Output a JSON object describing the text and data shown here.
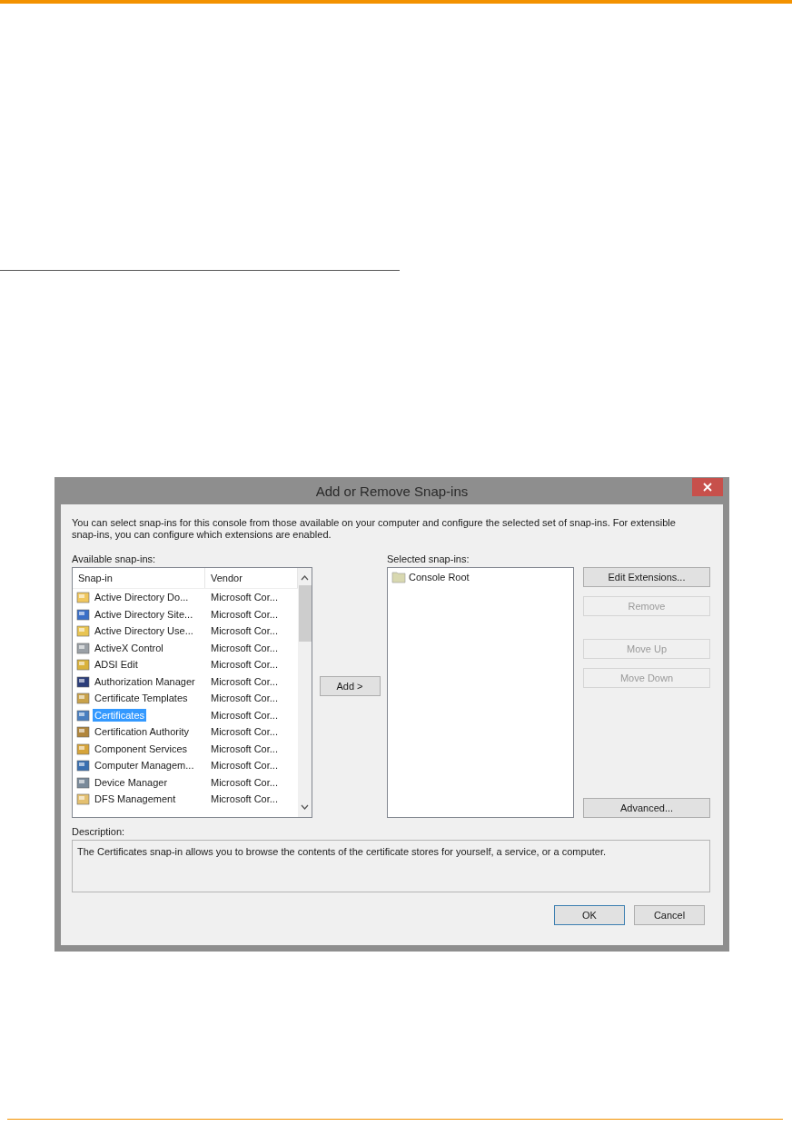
{
  "dialog": {
    "title": "Add or Remove Snap-ins",
    "intro": "You can select snap-ins for this console from those available on your computer and configure the selected set of snap-ins. For extensible snap-ins, you can configure which extensions are enabled.",
    "available_label": "Available snap-ins:",
    "available": {
      "columns": [
        "Snap-in",
        "Vendor"
      ],
      "rows": [
        {
          "name": "Active Directory Do...",
          "vendor": "Microsoft Cor...",
          "selected": false
        },
        {
          "name": "Active Directory Site...",
          "vendor": "Microsoft Cor...",
          "selected": false
        },
        {
          "name": "Active Directory Use...",
          "vendor": "Microsoft Cor...",
          "selected": false
        },
        {
          "name": "ActiveX Control",
          "vendor": "Microsoft Cor...",
          "selected": false
        },
        {
          "name": "ADSI Edit",
          "vendor": "Microsoft Cor...",
          "selected": false
        },
        {
          "name": "Authorization Manager",
          "vendor": "Microsoft Cor...",
          "selected": false
        },
        {
          "name": "Certificate Templates",
          "vendor": "Microsoft Cor...",
          "selected": false
        },
        {
          "name": "Certificates",
          "vendor": "Microsoft Cor...",
          "selected": true
        },
        {
          "name": "Certification Authority",
          "vendor": "Microsoft Cor...",
          "selected": false
        },
        {
          "name": "Component Services",
          "vendor": "Microsoft Cor...",
          "selected": false
        },
        {
          "name": "Computer Managem...",
          "vendor": "Microsoft Cor...",
          "selected": false
        },
        {
          "name": "Device Manager",
          "vendor": "Microsoft Cor...",
          "selected": false
        },
        {
          "name": "DFS Management",
          "vendor": "Microsoft Cor...",
          "selected": false
        }
      ]
    },
    "add_button": "Add >",
    "selected_label": "Selected snap-ins:",
    "selected_items": [
      {
        "label": "Console Root"
      }
    ],
    "side_buttons": [
      {
        "label": "Edit Extensions...",
        "disabled": false
      },
      {
        "label": "Remove",
        "disabled": true
      },
      {
        "label": "Move Up",
        "disabled": true
      },
      {
        "label": "Move Down",
        "disabled": true
      },
      {
        "label": "Advanced...",
        "disabled": false
      }
    ],
    "description_label": "Description:",
    "description": "The Certificates snap-in allows you to browse the contents of the certificate stores for yourself, a service, or a computer.",
    "buttons": [
      {
        "label": "OK",
        "default": true
      },
      {
        "label": "Cancel",
        "default": false
      }
    ]
  }
}
